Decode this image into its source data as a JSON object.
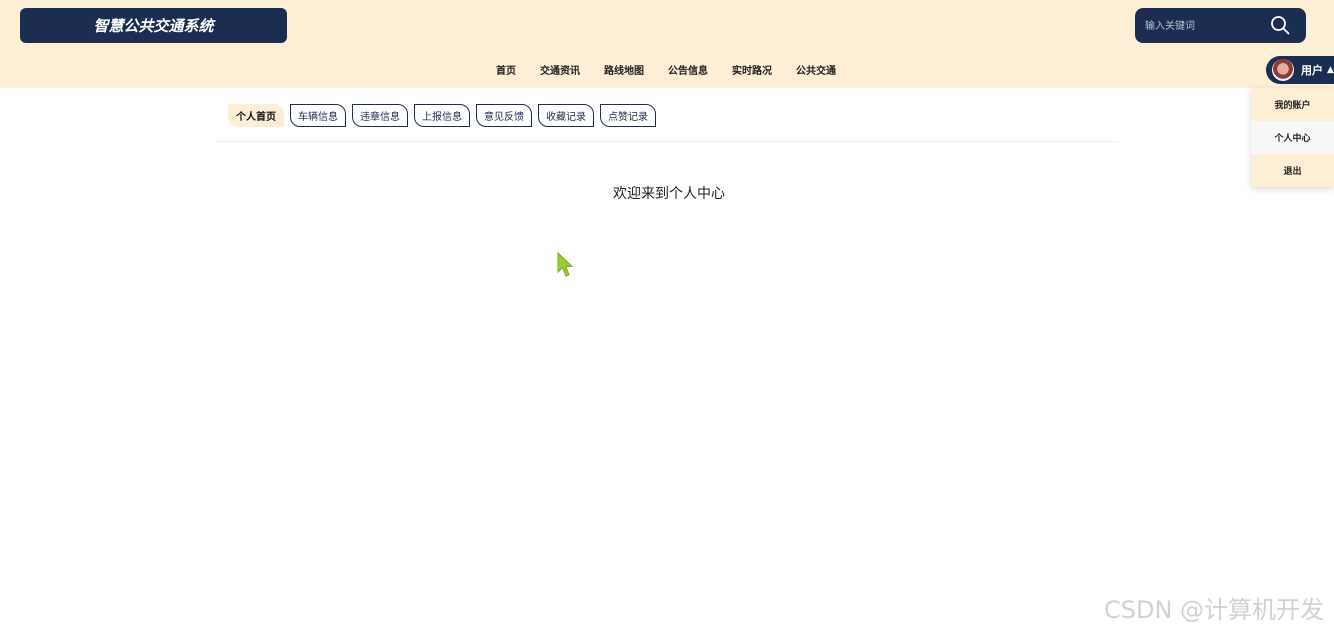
{
  "header": {
    "brand_title": "智慧公共交通系统",
    "search_placeholder": "输入关键词",
    "nav": [
      "首页",
      "交通资讯",
      "路线地图",
      "公告信息",
      "实时路况",
      "公共交通"
    ],
    "user_label": "用户",
    "user_menu": [
      "我的账户",
      "个人中心",
      "退出"
    ],
    "active_user_menu": "个人中心"
  },
  "tabs": [
    "个人首页",
    "车辆信息",
    "违章信息",
    "上报信息",
    "意见反馈",
    "收藏记录",
    "点赞记录"
  ],
  "active_tab": "个人首页",
  "main": {
    "welcome_text": "欢迎来到个人中心"
  },
  "watermark": "CSDN @计算机开发",
  "colors": {
    "header_bg": "#fcefd6",
    "navy": "#1b2e52",
    "cursor": "#9acd32"
  },
  "icons": {
    "search": "search-icon",
    "caret": "caret-up-icon",
    "cursor": "mouse-pointer-icon"
  }
}
